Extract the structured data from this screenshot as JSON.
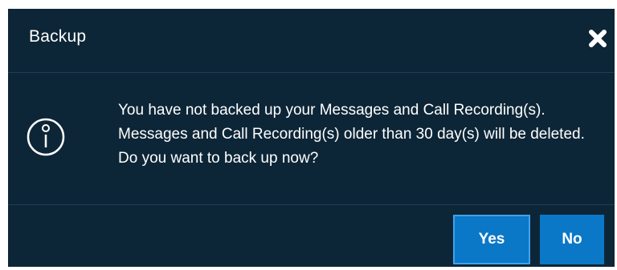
{
  "dialog": {
    "title": "Backup",
    "close_icon": "close-icon",
    "info_icon": "info-icon",
    "message": "You have not backed up your Messages and Call Recording(s). Messages and Call Recording(s) older than 30 day(s) will be deleted. Do you want to back up now?",
    "buttons": {
      "yes_label": "Yes",
      "no_label": "No"
    }
  },
  "colors": {
    "background": "#0d2637",
    "button": "#0b78c7",
    "text": "#ffffff"
  }
}
